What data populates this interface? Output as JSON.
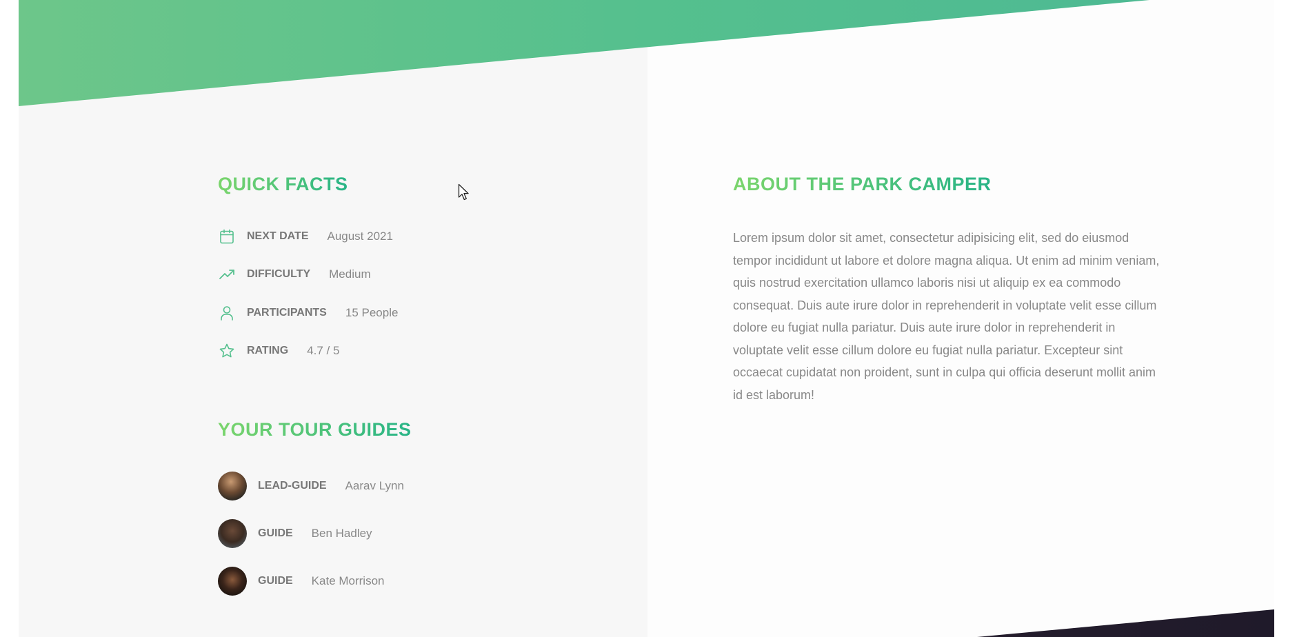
{
  "quick_facts": {
    "title": "QUICK FACTS",
    "items": [
      {
        "icon": "calendar-icon",
        "label": "NEXT DATE",
        "value": "August 2021"
      },
      {
        "icon": "trending-up-icon",
        "label": "DIFFICULTY",
        "value": "Medium"
      },
      {
        "icon": "user-icon",
        "label": "PARTICIPANTS",
        "value": "15 People"
      },
      {
        "icon": "star-icon",
        "label": "RATING",
        "value": "4.7 / 5"
      }
    ]
  },
  "tour_guides": {
    "title": "YOUR TOUR GUIDES",
    "items": [
      {
        "role": "LEAD-GUIDE",
        "name": "Aarav Lynn"
      },
      {
        "role": "GUIDE",
        "name": "Ben Hadley"
      },
      {
        "role": "GUIDE",
        "name": "Kate Morrison"
      }
    ]
  },
  "about": {
    "title": "ABOUT THE PARK CAMPER",
    "description": "Lorem ipsum dolor sit amet, consectetur adipisicing elit, sed do eiusmod tempor incididunt ut labore et dolore magna aliqua. Ut enim ad minim veniam, quis nostrud exercitation ullamco laboris nisi ut aliquip ex ea commodo consequat. Duis aute irure dolor in reprehenderit in voluptate velit esse cillum dolore eu fugiat nulla pariatur. Duis aute irure dolor in reprehenderit in voluptate velit esse cillum dolore eu fugiat nulla pariatur. Excepteur sint occaecat cupidatat non proident, sunt in culpa qui officia deserunt mollit anim id est laborum!"
  },
  "colors": {
    "accent_start": "#7bd56c",
    "accent_end": "#28b487",
    "label_text": "#777777",
    "value_text": "#888888"
  }
}
